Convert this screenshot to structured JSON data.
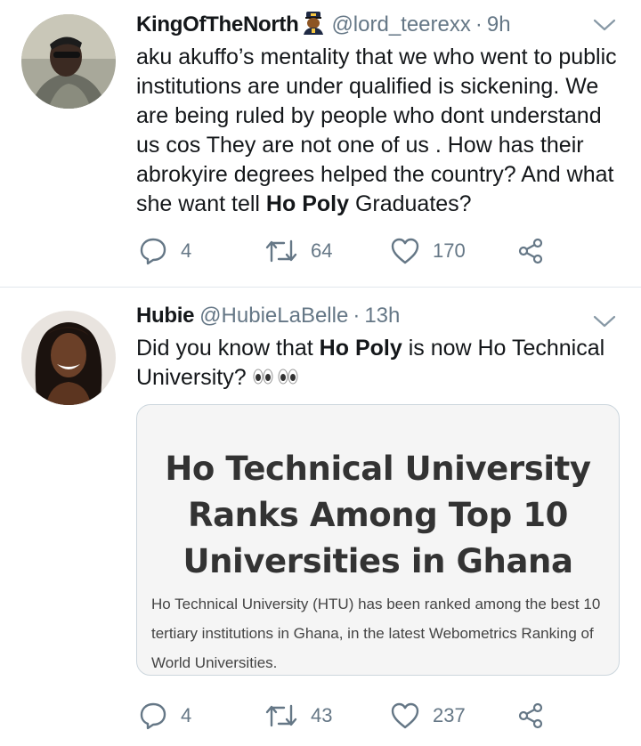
{
  "tweets": [
    {
      "name": "KingOfTheNorth",
      "name_emoji": "police-officer-emoji",
      "handle": "@lord_teerexx",
      "time": "9h",
      "text_before": "aku akuffo’s mentality that we who went to public institutions are under qualified is sickening. We are being ruled by people who dont understand us cos They are not one of us . How has their abrokyire degrees helped the country? And what she want tell ",
      "text_bold": "Ho Poly",
      "text_after": " Graduates?",
      "replies": "4",
      "retweets": "64",
      "likes": "170"
    },
    {
      "name": "Hubie",
      "handle": "@HubieLaBelle",
      "time": "13h",
      "text_before": "Did you know that ",
      "text_bold": "Ho Poly",
      "text_after": " is now Ho Technical University? ",
      "text_emoji": "eyes-emoji",
      "card": {
        "title": "Ho Technical University Ranks Among Top 10 Universities in Ghana",
        "description": "Ho Technical University (HTU) has been ranked among the best 10 tertiary institutions in Ghana, in the latest Webometrics Ranking of World Universities."
      },
      "replies": "4",
      "retweets": "43",
      "likes": "237"
    }
  ],
  "colors": {
    "text": "#14171a",
    "muted": "#657786",
    "divider": "#e1e8ed",
    "card_bg": "#f5f5f5"
  },
  "separator": "·"
}
